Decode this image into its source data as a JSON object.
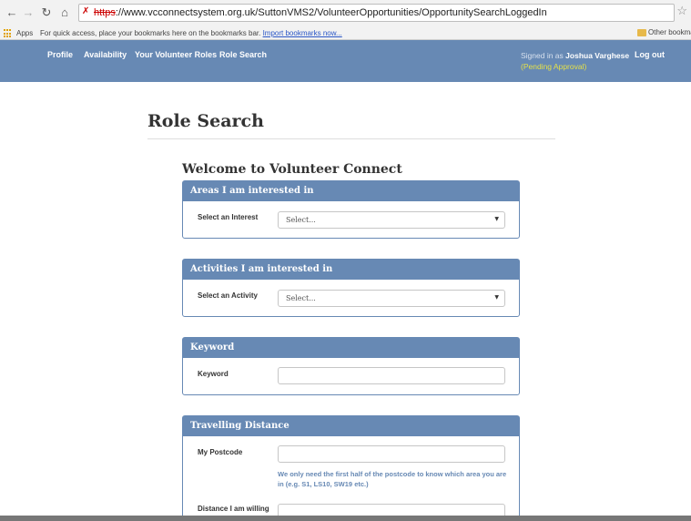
{
  "browser": {
    "back_icon": "back-arrow-icon",
    "forward_icon": "forward-arrow-icon",
    "reload_icon": "reload-icon",
    "home_icon": "home-icon",
    "url_scheme": "https",
    "url_rest": "://www.vcconnectsystem.org.uk/SuttonVMS2/VolunteerOpportunities/OpportunitySearchLoggedIn",
    "apps_label": "Apps",
    "bookmarks_hint": "For quick access, place your bookmarks here on the bookmarks bar.",
    "import_link": "Import bookmarks now...",
    "other_bookmarks": "Other bookma"
  },
  "navbar": {
    "items": [
      {
        "label": "Profile"
      },
      {
        "label": "Availability"
      },
      {
        "label": "Your Volunteer Roles"
      },
      {
        "label": "Role Search"
      }
    ],
    "signed_in_prefix": "Signed in as",
    "user_name": "Joshua Varghese",
    "pending": "(Pending Approval)",
    "logout": "Log out"
  },
  "page": {
    "title": "Role Search",
    "welcome": "Welcome to Volunteer Connect"
  },
  "panels": {
    "areas": {
      "heading": "Areas I am interested in",
      "label": "Select an Interest",
      "value": "Select..."
    },
    "activities": {
      "heading": "Activities I am interested in",
      "label": "Select an Activity",
      "value": "Select..."
    },
    "keyword": {
      "heading": "Keyword",
      "label": "Keyword",
      "value": ""
    },
    "distance": {
      "heading": "Travelling Distance",
      "postcode_label": "My Postcode",
      "postcode_value": "",
      "postcode_help": "We only need the first half of the postcode to know which area you are in (e.g. S1, LS10, SW19 etc.)",
      "distance_label": "Distance I am willing to travel",
      "distance_value": ""
    }
  }
}
